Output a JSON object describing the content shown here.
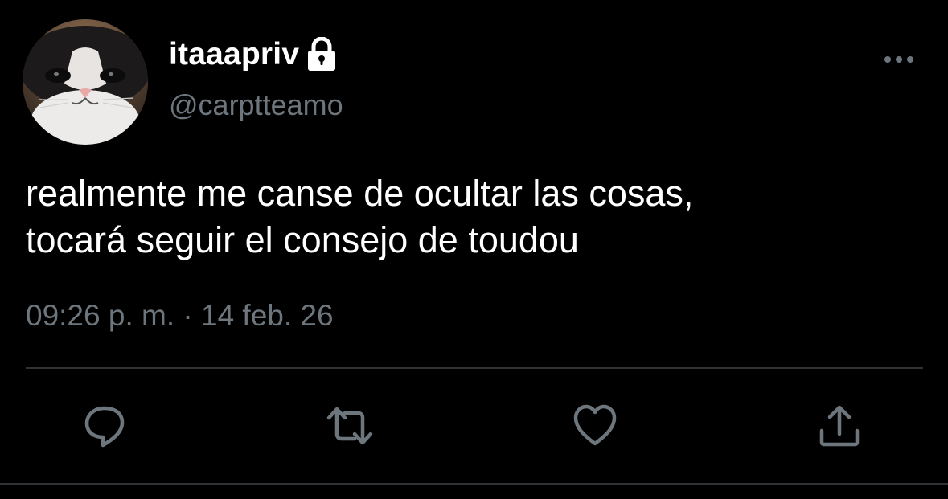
{
  "user": {
    "display_name": "itaaapriv",
    "handle": "@carptteamo",
    "avatar": "cat-photo-avatar",
    "protected_icon": "lock-icon"
  },
  "tweet": {
    "text": "realmente me canse de ocultar las cosas,\ntocará seguir el consejo de toudou",
    "timestamp": "09:26 p. m. · 14 feb. 26"
  },
  "actions": [
    {
      "icon": "reply-icon"
    },
    {
      "icon": "retweet-icon"
    },
    {
      "icon": "like-icon"
    },
    {
      "icon": "share-icon"
    }
  ],
  "more_menu_icon": "more-options-icon",
  "colors": {
    "background": "#000000",
    "primary_text": "#ffffff",
    "secondary_text": "#6e767d",
    "icon": "#6e767d",
    "divider": "#2f3336"
  }
}
